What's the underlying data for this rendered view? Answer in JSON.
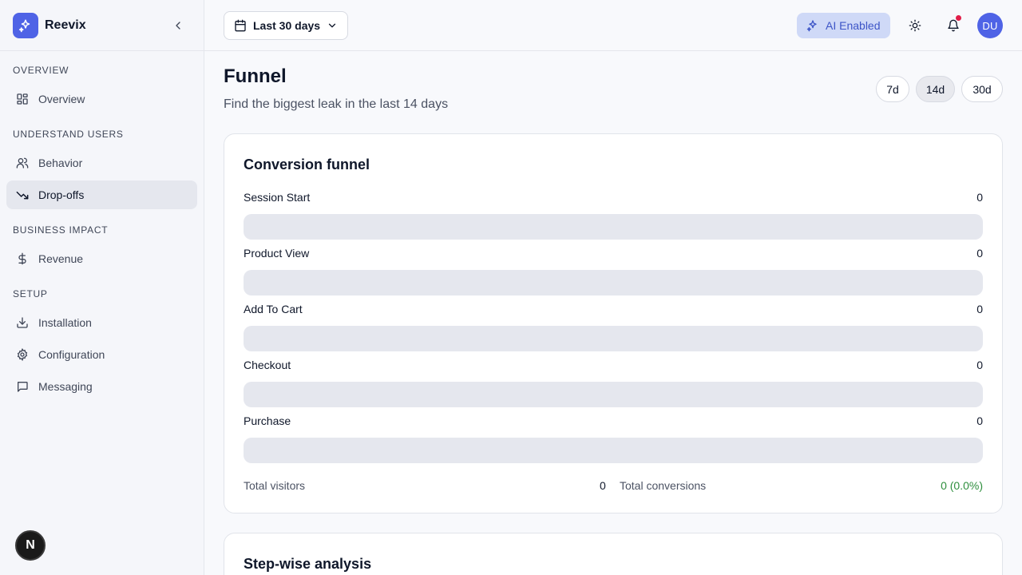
{
  "brand": {
    "name": "Reevix",
    "accent": "#4f63e6"
  },
  "sidebar": {
    "sections": [
      {
        "title": "OVERVIEW",
        "items": [
          {
            "label": "Overview",
            "icon": "grid-icon",
            "active": false
          }
        ]
      },
      {
        "title": "UNDERSTAND USERS",
        "items": [
          {
            "label": "Behavior",
            "icon": "users-icon",
            "active": false
          },
          {
            "label": "Drop-offs",
            "icon": "trending-down-icon",
            "active": true
          }
        ]
      },
      {
        "title": "BUSINESS IMPACT",
        "items": [
          {
            "label": "Revenue",
            "icon": "dollar-icon",
            "active": false
          }
        ]
      },
      {
        "title": "SETUP",
        "items": [
          {
            "label": "Installation",
            "icon": "download-icon",
            "active": false
          },
          {
            "label": "Configuration",
            "icon": "gear-icon",
            "active": false
          },
          {
            "label": "Messaging",
            "icon": "message-icon",
            "active": false
          }
        ]
      }
    ],
    "footer_badge": "N"
  },
  "header": {
    "date_range": "Last 30 days",
    "ai_label": "AI Enabled",
    "avatar_initials": "DU"
  },
  "page": {
    "title": "Funnel",
    "subtitle": "Find the biggest leak in the last 14 days",
    "ranges": [
      {
        "label": "7d",
        "active": false
      },
      {
        "label": "14d",
        "active": true
      },
      {
        "label": "30d",
        "active": false
      }
    ]
  },
  "funnel": {
    "title": "Conversion funnel",
    "steps": [
      {
        "label": "Session Start",
        "value": "0",
        "fill": 0
      },
      {
        "label": "Product View",
        "value": "0",
        "fill": 0
      },
      {
        "label": "Add To Cart",
        "value": "0",
        "fill": 0
      },
      {
        "label": "Checkout",
        "value": "0",
        "fill": 0
      },
      {
        "label": "Purchase",
        "value": "0",
        "fill": 0
      }
    ],
    "total_visitors_label": "Total visitors",
    "total_visitors_value": "0",
    "total_conversions_label": "Total conversions",
    "total_conversions_value": "0 (0.0%)"
  },
  "stepwise": {
    "title": "Step-wise analysis"
  }
}
